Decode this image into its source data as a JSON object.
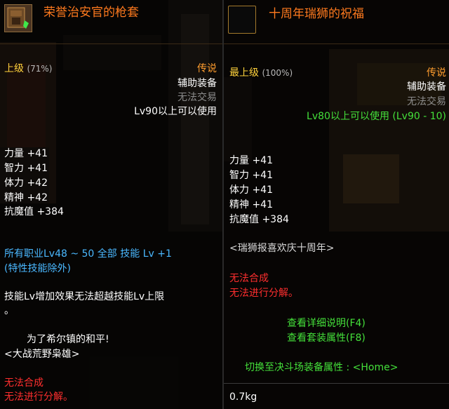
{
  "left": {
    "title": "荣誉治安官的枪套",
    "grade": "上级",
    "grade_pct": "(71%)",
    "rarity": "传说",
    "type": "辅助装备",
    "trade": "无法交易",
    "level_req": "Lv90以上可以使用",
    "stats": [
      {
        "label": "力量",
        "value": "+41"
      },
      {
        "label": "智力",
        "value": "+41"
      },
      {
        "label": "体力",
        "value": "+42"
      },
      {
        "label": "精神",
        "value": "+42"
      },
      {
        "label": "抗魔值",
        "value": "+384"
      }
    ],
    "skill_line1": "所有职业Lv48 ~ 50 全部 技能 Lv +1",
    "skill_line2": "(特性技能除外)",
    "skill_limit_line1": "技能Lv增加效果无法超越技能Lv上限",
    "skill_limit_line2": "。",
    "flavor_line1": "为了希尔镇的和平!",
    "flavor_line2": "<大战荒野枭雄>",
    "no_synth": "无法合成",
    "no_disassemble": "无法进行分解。"
  },
  "right": {
    "title": "十周年瑞狮的祝福",
    "grade": "最上级",
    "grade_pct": "(100%)",
    "rarity": "传说",
    "type": "辅助装备",
    "trade": "无法交易",
    "level_req": "Lv80以上可以使用 (Lv90 - 10)",
    "stats": [
      {
        "label": "力量",
        "value": "+41"
      },
      {
        "label": "智力",
        "value": "+41"
      },
      {
        "label": "体力",
        "value": "+41"
      },
      {
        "label": "精神",
        "value": "+41"
      },
      {
        "label": "抗魔值",
        "value": "+384"
      }
    ],
    "flavor": "<瑞狮报喜欢庆十周年>",
    "no_synth": "无法合成",
    "no_disassemble": "无法进行分解。",
    "detail_link": "查看详细说明(F4)",
    "set_link": "查看套装属性(F8)",
    "arena_link": "切换至决斗场装备属性 : <Home>",
    "weight": "0.7kg"
  },
  "colors": {
    "title": "#ff7a1e",
    "grade": "#ffd23c",
    "rarity": "#ff9d2e",
    "red": "#ff2e2e",
    "green": "#44e03a",
    "cyan": "#4ab8ff",
    "grey": "#8c8c8c"
  },
  "icons": {
    "left_item": "holster-item-icon",
    "right_item": "empty-item-slot-icon"
  }
}
